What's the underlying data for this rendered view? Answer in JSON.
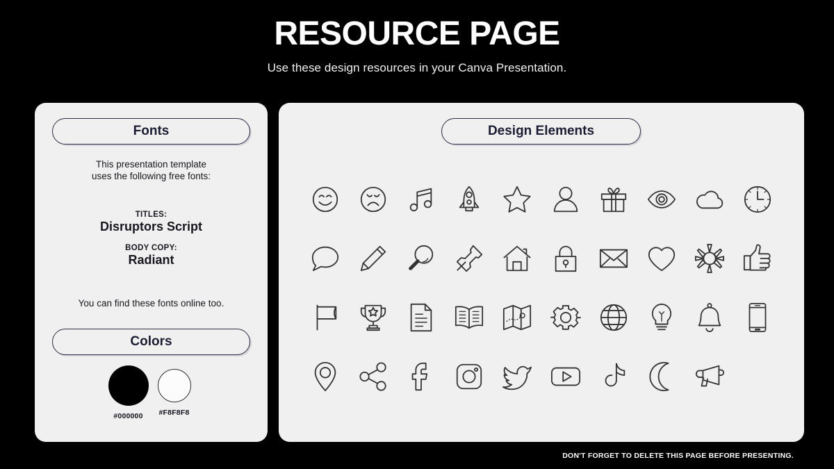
{
  "header": {
    "title": "RESOURCE PAGE",
    "subtitle": "Use these design resources in your Canva Presentation."
  },
  "fonts_panel": {
    "pill_label": "Fonts",
    "intro_line_1": "This presentation template",
    "intro_line_2": "uses the following free fonts:",
    "titles_role": "TITLES:",
    "titles_font": "Disruptors Script",
    "body_role": "BODY COPY:",
    "body_font": "Radiant",
    "outro": "You can find these fonts online too."
  },
  "colors_panel": {
    "pill_label": "Colors",
    "swatches": [
      {
        "hex": "#000000",
        "label": "#000000"
      },
      {
        "hex": "#F8F8F8",
        "label": "#F8F8F8"
      }
    ]
  },
  "elements_panel": {
    "pill_label": "Design Elements",
    "icons": [
      "smiley-face-icon",
      "sad-face-icon",
      "music-note-icon",
      "rocket-icon",
      "star-icon",
      "person-icon",
      "gift-icon",
      "eye-icon",
      "cloud-icon",
      "clock-icon",
      "speech-bubble-icon",
      "pencil-icon",
      "magnifying-glass-icon",
      "pushpin-icon",
      "house-icon",
      "lock-icon",
      "envelope-icon",
      "heart-icon",
      "sun-icon",
      "thumbs-up-icon",
      "flag-icon",
      "trophy-icon",
      "document-icon",
      "open-book-icon",
      "map-icon",
      "gear-icon",
      "globe-icon",
      "lightbulb-icon",
      "bell-icon",
      "smartphone-icon",
      "location-pin-icon",
      "share-icon",
      "facebook-icon",
      "instagram-icon",
      "twitter-icon",
      "youtube-icon",
      "tiktok-icon",
      "moon-icon",
      "megaphone-icon"
    ]
  },
  "footer": {
    "note": "DON'T FORGET TO DELETE THIS PAGE BEFORE PRESENTING."
  },
  "theme": {
    "background": "#000000",
    "panel_background": "#F0F0F0",
    "accent_border": "#2B2D42",
    "icon_stroke": "#333333",
    "text_light": "#FFFFFF"
  }
}
